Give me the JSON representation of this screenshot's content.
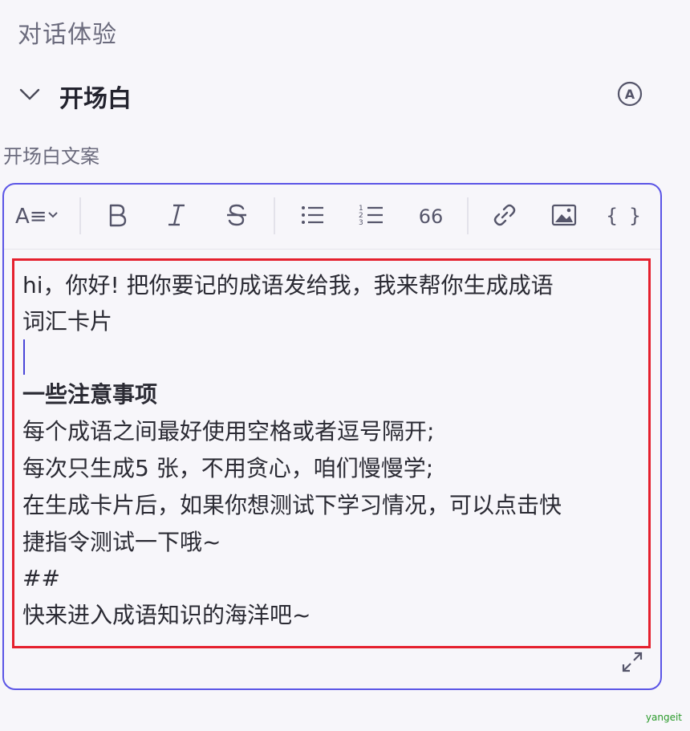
{
  "section": {
    "title": "对话体验"
  },
  "collapse": {
    "title": "开场白",
    "ai_badge": "A"
  },
  "field": {
    "label": "开场白文案"
  },
  "toolbar": {
    "heading_label": "A≡",
    "quote_label": "66",
    "code_label": "{ }"
  },
  "content": {
    "lines": [
      "hi，你好! 把你要记的成语发给我，我来帮你生成成语",
      "词汇卡片",
      "",
      "一些注意事项",
      "每个成语之间最好使用空格或者逗号隔开;",
      "每次只生成5 张，不用贪心，咱们慢慢学;",
      "在生成卡片后，如果你想测试下学习情况，可以点击快",
      "捷指令测试一下哦~",
      "##",
      "快来进入成语知识的海洋吧~"
    ]
  },
  "watermark": "yangeit",
  "colors": {
    "accent": "#5b55e6",
    "highlight_border": "#e5202e"
  }
}
